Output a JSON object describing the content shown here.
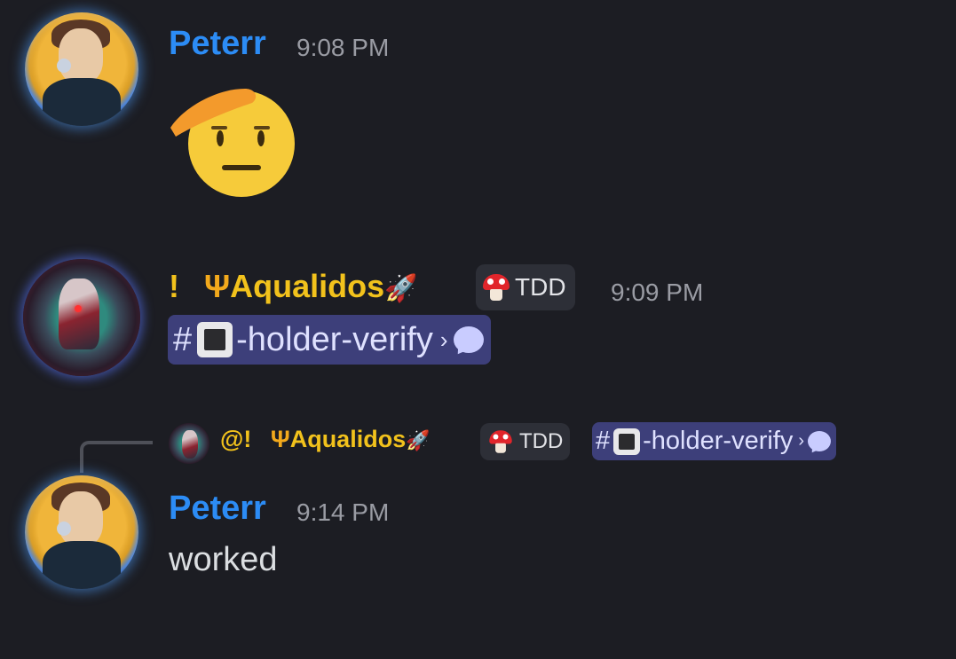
{
  "messages": [
    {
      "author": "Peterr",
      "time": "9:08 PM",
      "content_emoji": "saluting-face"
    },
    {
      "author_prefix": "!",
      "author": "Aqualidos",
      "role_badge": "TDD",
      "time": "9:09 PM",
      "channel_mention": "-holder-verify"
    },
    {
      "reply_to": {
        "author_prefix": "@!",
        "author": "Aqualidos",
        "role_badge": "TDD",
        "channel_mention": "-holder-verify"
      },
      "author": "Peterr",
      "time": "9:14 PM",
      "text": "worked"
    }
  ],
  "icons": {
    "trident": "trident-emoji",
    "rocket": "rocket-emoji",
    "role": "mushroom-icon",
    "thread": "speech-bubble-icon",
    "channel_square": "black-square-emoji"
  },
  "colors": {
    "background": "#1c1d23",
    "username_peterr": "#2c8cf5",
    "username_aqualidos": "#f2c21c",
    "mention_bg": "#3d3f7a"
  }
}
